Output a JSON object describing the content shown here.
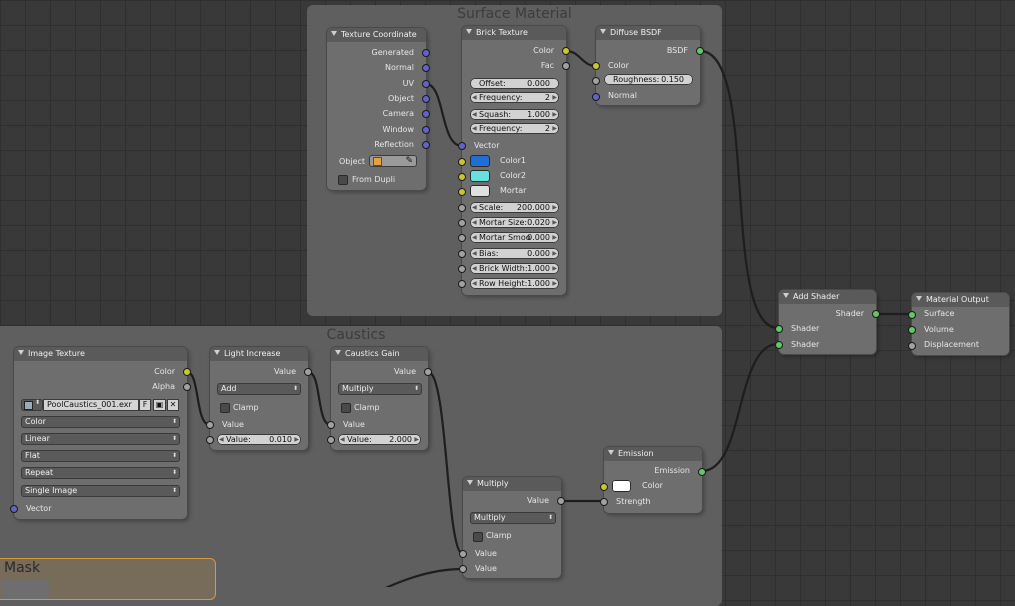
{
  "frames": {
    "surface": "Surface Material",
    "caustics": "Caustics",
    "mask": "Mask"
  },
  "texture_coordinate": {
    "title": "Texture Coordinate",
    "outputs": [
      "Generated",
      "Normal",
      "UV",
      "Object",
      "Camera",
      "Window",
      "Reflection"
    ],
    "object_label": "Object",
    "from_dupli": "From Dupli"
  },
  "brick_texture": {
    "title": "Brick Texture",
    "out_color": "Color",
    "out_fac": "Fac",
    "offset_label": "Offset:",
    "offset_value": "0.000",
    "freq1_label": "Frequency:",
    "freq1_value": "2",
    "squash_label": "Squash:",
    "squash_value": "1.000",
    "freq2_label": "Frequency:",
    "freq2_value": "2",
    "vector": "Vector",
    "color1": "Color1",
    "color2": "Color2",
    "mortar": "Mortar",
    "color1_hex": "#1f6fd6",
    "color2_hex": "#66e0e0",
    "mortar_hex": "#e0e0e0",
    "scale_label": "Scale:",
    "scale_value": "200.000",
    "mortar_size_label": "Mortar Size:",
    "mortar_size_value": "0.020",
    "mortar_smooth_label": "Mortar Smoo",
    "mortar_smooth_value": "0.000",
    "bias_label": "Bias:",
    "bias_value": "0.000",
    "brick_width_label": "Brick Width:",
    "brick_width_value": "1.000",
    "row_height_label": "Row Height:",
    "row_height_value": "1.000"
  },
  "diffuse_bsdf": {
    "title": "Diffuse BSDF",
    "out_bsdf": "BSDF",
    "in_color": "Color",
    "roughness_label": "Roughness:",
    "roughness_value": "0.150",
    "in_normal": "Normal"
  },
  "add_shader": {
    "title": "Add Shader",
    "out_shader": "Shader",
    "in_shader1": "Shader",
    "in_shader2": "Shader"
  },
  "material_output": {
    "title": "Material Output",
    "surface": "Surface",
    "volume": "Volume",
    "displacement": "Displacement"
  },
  "image_texture": {
    "title": "Image Texture",
    "out_color": "Color",
    "out_alpha": "Alpha",
    "filename": "PoolCaustics_001.exr",
    "f_button": "F",
    "color_space": "Color",
    "interpolation": "Linear",
    "projection": "Flat",
    "extension": "Repeat",
    "source": "Single Image",
    "in_vector": "Vector"
  },
  "light_increase": {
    "title": "Light Increase",
    "out_value": "Value",
    "operation": "Add",
    "clamp": "Clamp",
    "in_value": "Value",
    "value_label": "Value:",
    "value_value": "0.010"
  },
  "caustics_gain": {
    "title": "Caustics Gain",
    "out_value": "Value",
    "operation": "Multiply",
    "clamp": "Clamp",
    "in_value": "Value",
    "value_label": "Value:",
    "value_value": "2.000"
  },
  "multiply": {
    "title": "Multiply",
    "out_value": "Value",
    "operation": "Multiply",
    "clamp": "Clamp",
    "in_value1": "Value",
    "in_value2": "Value"
  },
  "emission": {
    "title": "Emission",
    "out_emission": "Emission",
    "in_color": "Color",
    "in_strength": "Strength",
    "color_hex": "#ffffff"
  }
}
